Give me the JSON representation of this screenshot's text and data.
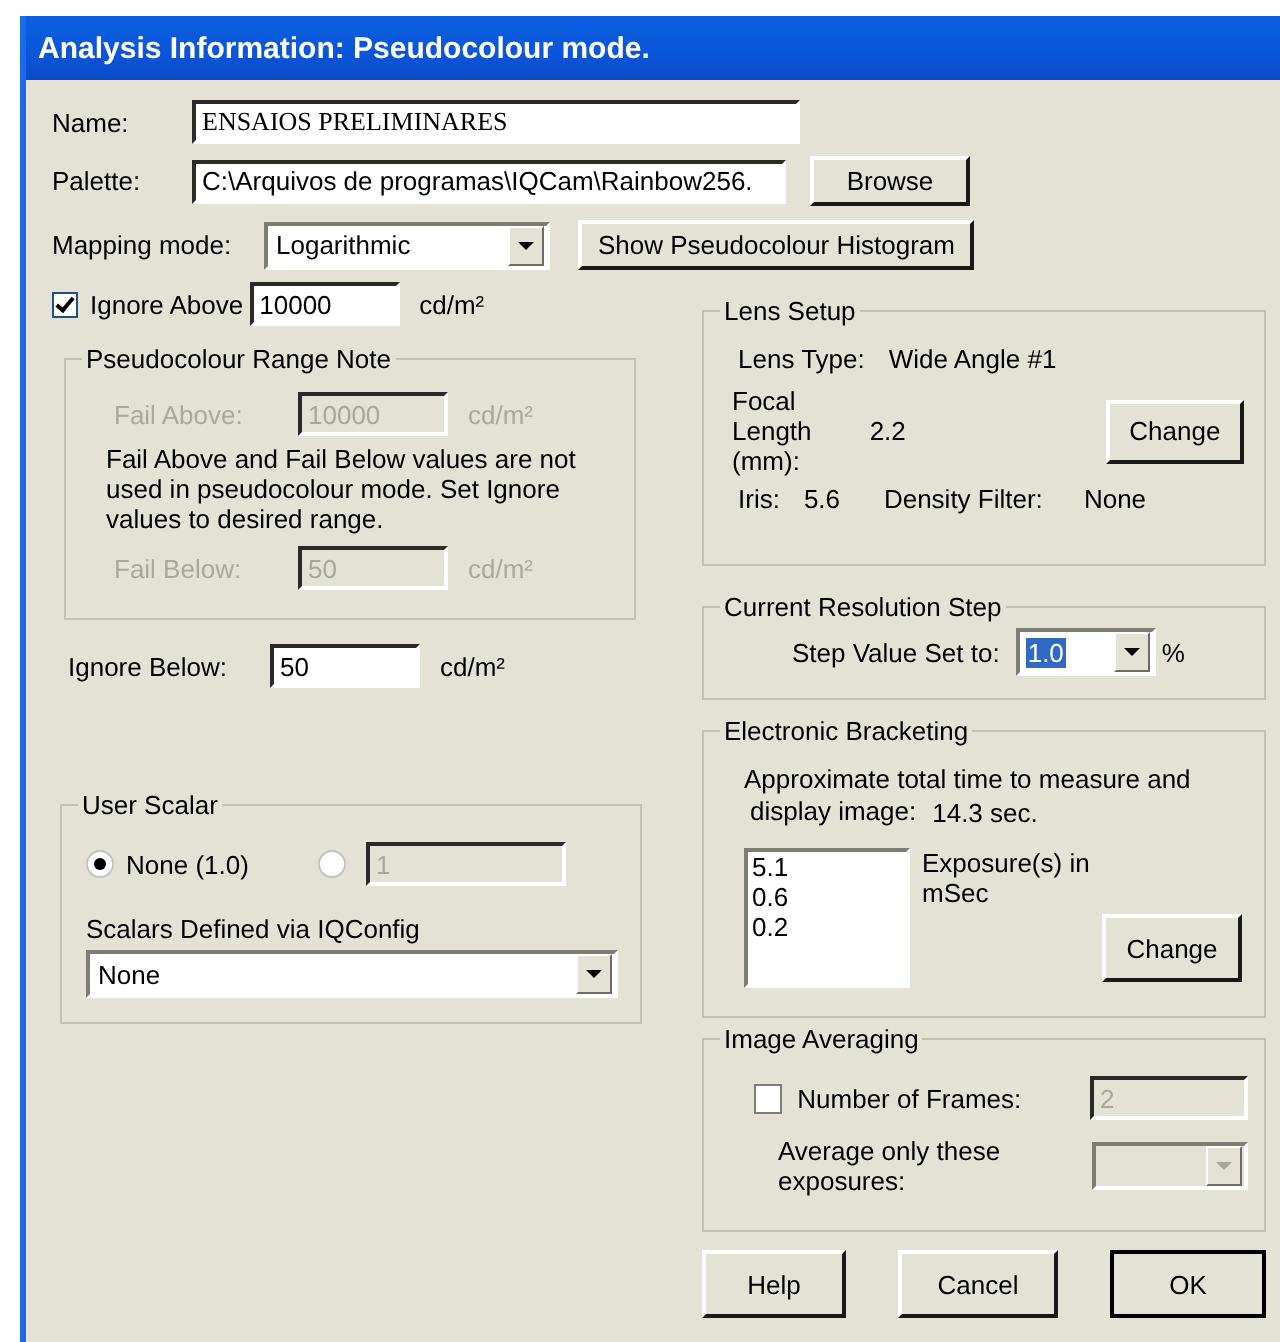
{
  "window": {
    "title": "Analysis Information: Pseudocolour mode."
  },
  "name": {
    "label": "Name:",
    "value": "ENSAIOS PRELIMINARES"
  },
  "palette": {
    "label": "Palette:",
    "value": "C:\\Arquivos de programas\\IQCam\\Rainbow256.",
    "button": "Browse"
  },
  "mapping": {
    "label": "Mapping mode:",
    "value": "Logarithmic",
    "button": "Show Pseudocolour Histogram"
  },
  "ignore_above": {
    "label": "Ignore Above",
    "checked": true,
    "value": "10000",
    "unit": "cd/m²"
  },
  "range_note": {
    "title": "Pseudocolour Range Note",
    "fail_above": {
      "label": "Fail Above:",
      "value": "10000",
      "unit": "cd/m²",
      "disabled": true
    },
    "note": "Fail Above and Fail Below values are not used in pseudocolour mode. Set Ignore values to desired range.",
    "fail_below": {
      "label": "Fail Below:",
      "value": "50",
      "unit": "cd/m²",
      "disabled": true
    }
  },
  "ignore_below": {
    "label": "Ignore Below:",
    "value": "50",
    "unit": "cd/m²"
  },
  "user_scalar": {
    "title": "User Scalar",
    "options": [
      {
        "label": "None (1.0)",
        "selected": true
      },
      {
        "value": "1",
        "selected": false,
        "disabled": true
      }
    ],
    "config_label": "Scalars Defined via IQConfig",
    "config_value": "None"
  },
  "lens_setup": {
    "title": "Lens Setup",
    "type_label": "Lens Type:",
    "type_value": "Wide Angle #1",
    "focal_label": "Focal Length (mm):",
    "focal_value": "2.2",
    "button": "Change",
    "iris_label": "Iris:",
    "iris_value": "5.6",
    "filter_label": "Density Filter:",
    "filter_value": "None"
  },
  "resolution": {
    "title": "Current Resolution Step",
    "label": "Step Value Set to:",
    "value": "1.0",
    "text_selected": true,
    "unit": "%"
  },
  "bracketing": {
    "title": "Electronic Bracketing",
    "estimate_lines": [
      "Approximate total time to measure and",
      "display image:"
    ],
    "estimate_value": "14.3 sec.",
    "exposures": [
      "5.1",
      "0.6",
      "0.2"
    ],
    "exposures_label": "Exposure(s) in mSec",
    "button": "Change"
  },
  "averaging": {
    "title": "Image Averaging",
    "frames_label": "Number of Frames:",
    "checked": false,
    "frames_value": "2",
    "frames_disabled": true,
    "only_label": "Average only these exposures:",
    "only_disabled": true
  },
  "buttons": [
    {
      "label": "Help",
      "default": false
    },
    {
      "label": "Cancel",
      "default": false
    },
    {
      "label": "OK",
      "default": true
    }
  ]
}
